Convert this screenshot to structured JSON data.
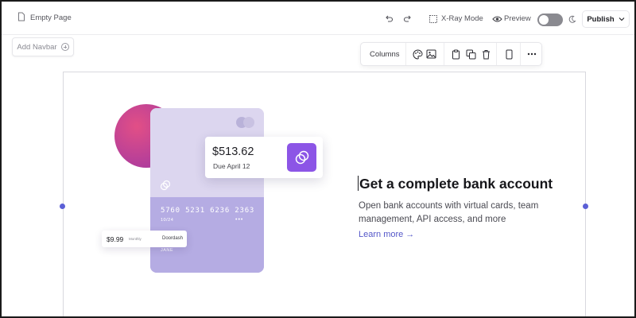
{
  "topbar": {
    "page_title": "Empty Page",
    "xray_label": "X-Ray Mode",
    "preview_label": "Preview",
    "publish_label": "Publish",
    "icons": [
      "page-icon",
      "undo-icon",
      "redo-icon",
      "xray-icon",
      "eye-icon",
      "moon-icon",
      "chevron-down-icon"
    ],
    "theme_toggle_on": false
  },
  "canvas": {
    "add_navbar_label": "Add Navbar",
    "toolbar": {
      "columns_label": "Columns",
      "icons": [
        "palette-icon",
        "image-icon",
        "clipboard-icon",
        "copy-icon",
        "trash-icon",
        "mobile-icon",
        "more-icon"
      ]
    }
  },
  "illustration": {
    "amount": "$513.62",
    "due": "Due April 12",
    "card_number": "5760 5231 6236 2363",
    "card_expiry": "10/24",
    "card_dots": "•••",
    "card_name": "JANE",
    "tx_amount": "$9.99",
    "tx_frequency": "Monthly",
    "tx_merchant": "Doordash"
  },
  "content": {
    "headline": "Get a complete bank account",
    "description": "Open bank accounts with virtual cards, team management, API access, and more",
    "learn_more": "Learn more →"
  },
  "colors": {
    "accent": "#5b5fd6",
    "purple_icon": "#8c55e6",
    "card": "#ccc4ea",
    "blob": "#c6438f"
  }
}
